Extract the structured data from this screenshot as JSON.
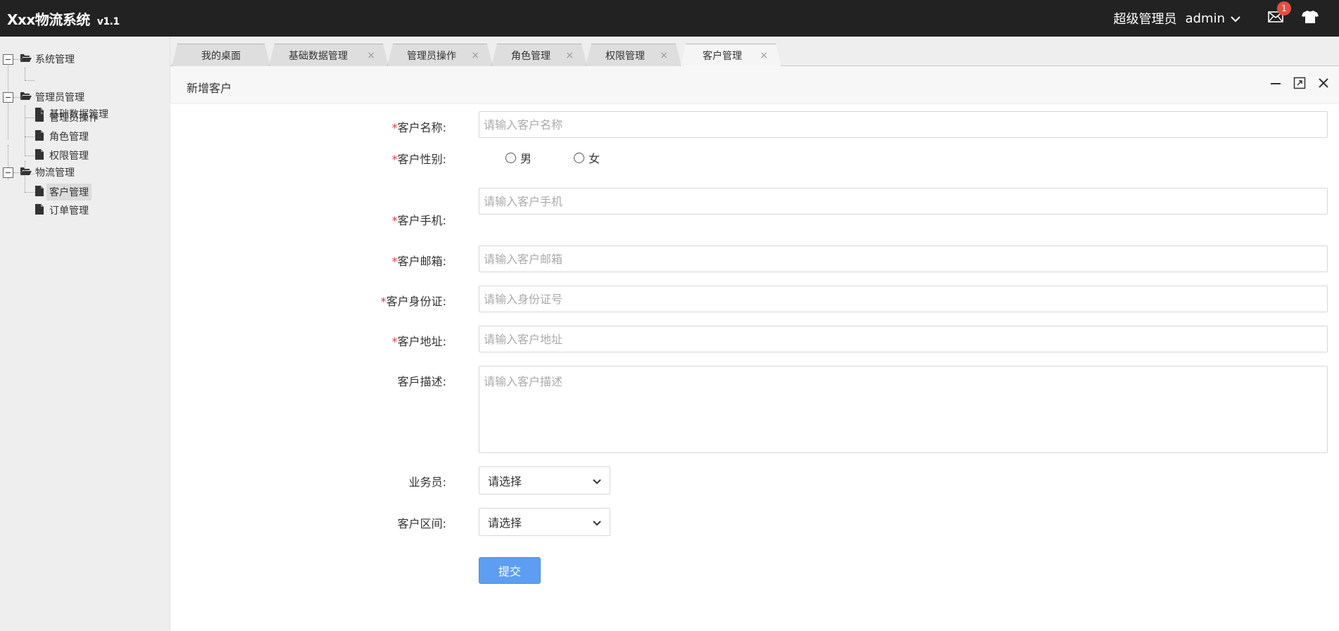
{
  "header": {
    "app_name": "Xxx物流系统",
    "version": "v1.1",
    "user_role": "超级管理员",
    "user_name": "admin",
    "mail_badge": "1"
  },
  "sidebar": {
    "groups": [
      {
        "label": "系统管理",
        "items": [
          "基础数据管理"
        ]
      },
      {
        "label": "管理员管理",
        "items": [
          "管理员操作",
          "角色管理",
          "权限管理"
        ]
      },
      {
        "label": "物流管理",
        "items": [
          "客户管理",
          "订单管理"
        ]
      }
    ],
    "active_item": "客户管理"
  },
  "tabs": [
    {
      "label": "我的桌面",
      "closable": false
    },
    {
      "label": "基础数据管理",
      "closable": true
    },
    {
      "label": "管理员操作",
      "closable": true
    },
    {
      "label": "角色管理",
      "closable": true
    },
    {
      "label": "权限管理",
      "closable": true
    },
    {
      "label": "客户管理",
      "closable": true,
      "active": true
    }
  ],
  "tab_close_glyph": "×",
  "panel": {
    "title": "新增客户"
  },
  "form": {
    "required_mark": "*",
    "name": {
      "label": "客户名称:",
      "placeholder": "请输入客户名称"
    },
    "gender": {
      "label": "客户性别:",
      "options": [
        "男",
        "女"
      ]
    },
    "phone": {
      "label": "客户手机:",
      "placeholder": "请输入客户手机"
    },
    "email": {
      "label": "客户邮箱:",
      "placeholder": "请输入客户邮箱"
    },
    "id_card": {
      "label": "客户身份证:",
      "placeholder": "请输入身份证号"
    },
    "address": {
      "label": "客户地址:",
      "placeholder": "请输入客户地址"
    },
    "description": {
      "label": "客戶描述:",
      "placeholder": "请输入客户描述"
    },
    "salesman": {
      "label": "业务员:",
      "selected": "请选择"
    },
    "region": {
      "label": "客户区间:",
      "selected": "请选择"
    },
    "submit_label": "提交"
  },
  "colors": {
    "header_bg": "#222222",
    "sidebar_bg": "#eeeeee",
    "accent": "#5d9ef3",
    "required": "#e4393c",
    "badge": "#e54d42"
  }
}
